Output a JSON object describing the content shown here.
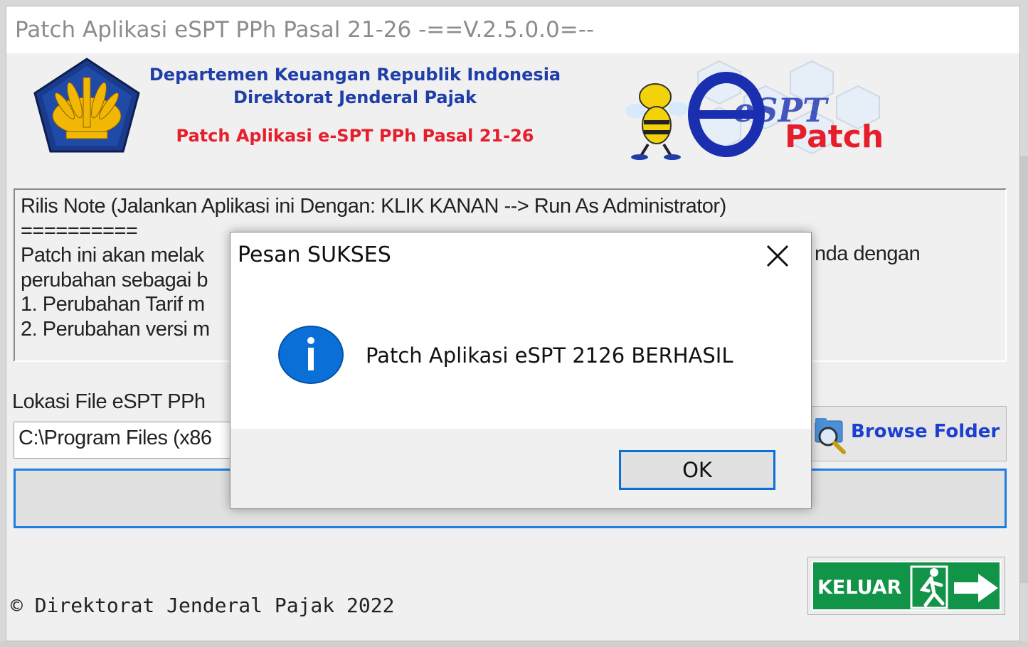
{
  "window": {
    "title": "Patch Aplikasi eSPT PPh Pasal 21-26 -==V.2.5.0.0=--"
  },
  "header": {
    "line1": "Departemen Keuangan Republik Indonesia",
    "line2": "Direktorat Jenderal Pajak",
    "line3": "Patch Aplikasi e-SPT PPh Pasal 21-26",
    "logo_text": "eSPT",
    "logo_sub": "Patch"
  },
  "notes": {
    "lines": [
      "Rilis Note (Jalankan Aplikasi ini Dengan: KLIK KANAN --> Run As Administrator)",
      "==========",
      "Patch ini akan melak",
      "perubahan sebagai b",
      "1. Perubahan Tarif m",
      "2. Perubahan versi m"
    ],
    "right_fragment": "nda dengan"
  },
  "location": {
    "label": "Lokasi File eSPT PPh",
    "value": "C:\\Program Files (x86"
  },
  "buttons": {
    "browse": "Browse Folder",
    "keluar": "KELUAR"
  },
  "footer": {
    "copyright": "© Direktorat Jenderal Pajak 2022"
  },
  "dialog": {
    "title": "Pesan SUKSES",
    "message": "Patch Aplikasi eSPT 2126 BERHASIL",
    "ok": "OK",
    "icon": "info-icon"
  },
  "colors": {
    "title_blue": "#1f3ea8",
    "title_red": "#e61e2b",
    "focus_blue": "#1e7fe0",
    "exit_green": "#119447",
    "info_blue": "#0a6fd6"
  }
}
